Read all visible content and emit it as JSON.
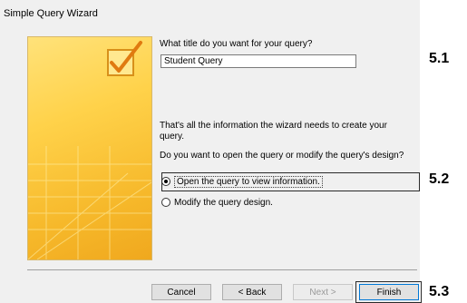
{
  "window": {
    "title": "Simple Query Wizard"
  },
  "prompt": {
    "title_question": "What title do you want for your query?",
    "title_value": "Student Query",
    "info_text": "That's all the information the wizard needs to create your query.",
    "open_question": "Do you want to open the query or modify the query's design?"
  },
  "options": [
    {
      "label": "Open the query to view information.",
      "selected": true
    },
    {
      "label": "Modify the query design.",
      "selected": false
    }
  ],
  "buttons": {
    "cancel": "Cancel",
    "back": "< Back",
    "next": "Next >",
    "finish": "Finish"
  },
  "annotations": {
    "m1": "5.1",
    "m2": "5.2",
    "m3": "5.3"
  },
  "icons": {
    "banner_check": "checkmark-icon"
  },
  "colors": {
    "accent": "#ffd24a",
    "focus": "#0078d7"
  }
}
